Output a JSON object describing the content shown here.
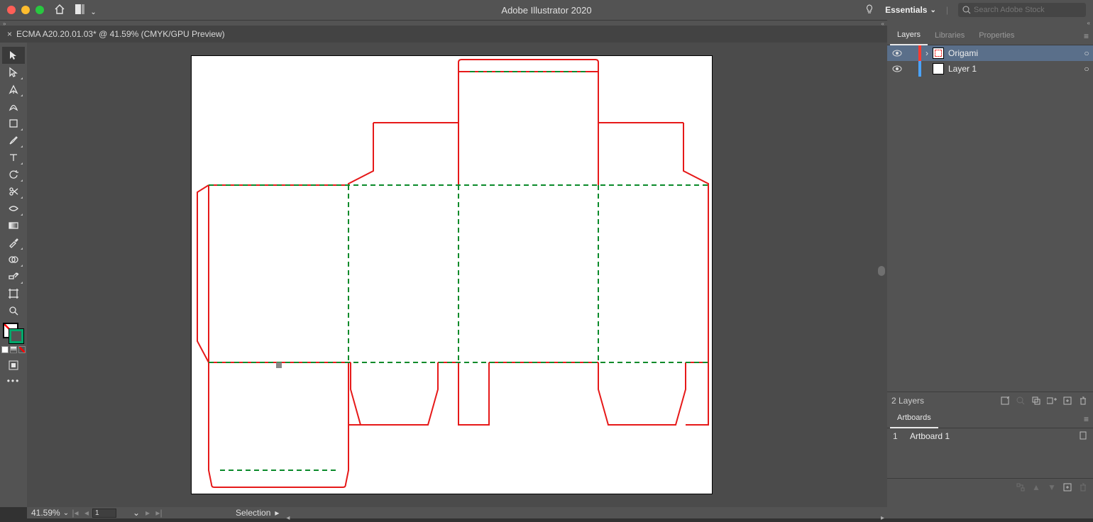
{
  "app": {
    "title": "Adobe Illustrator 2020"
  },
  "traffic_lights": {
    "close": "#ff5f57",
    "min": "#febc2e",
    "max": "#28c840"
  },
  "header": {
    "workspace_label": "Essentials",
    "search_placeholder": "Search Adobe Stock"
  },
  "document_tab": {
    "close_glyph": "×",
    "label": "ECMA A20.20.01.03* @ 41.59% (CMYK/GPU Preview)"
  },
  "tools": [
    {
      "name": "selection-tool",
      "selected": true
    },
    {
      "name": "direct-selection-tool"
    },
    {
      "name": "pen-tool"
    },
    {
      "name": "curvature-tool"
    },
    {
      "name": "rectangle-tool"
    },
    {
      "name": "paintbrush-tool"
    },
    {
      "name": "type-tool"
    },
    {
      "name": "rotate-tool"
    },
    {
      "name": "scissors-tool"
    },
    {
      "name": "width-tool"
    },
    {
      "name": "gradient-tool"
    },
    {
      "name": "eyedropper-tool"
    },
    {
      "name": "shape-builder-tool"
    },
    {
      "name": "symbol-sprayer-tool"
    },
    {
      "name": "artboard-tool"
    },
    {
      "name": "zoom-tool"
    }
  ],
  "panels": {
    "layers": {
      "tabs": [
        "Layers",
        "Libraries",
        "Properties"
      ],
      "active_tab": "Layers",
      "items": [
        {
          "name": "Origami",
          "color": "#ff3b30",
          "expandable": true,
          "thumb": "origami"
        },
        {
          "name": "Layer 1",
          "color": "#4aa3ff",
          "expandable": false,
          "thumb": "blank"
        }
      ],
      "footer_count": "2 Layers"
    },
    "artboards": {
      "title": "Artboards",
      "items": [
        {
          "index": "1",
          "name": "Artboard 1"
        }
      ]
    }
  },
  "status": {
    "zoom": "41.59%",
    "artboard_number": "1",
    "current_tool": "Selection"
  },
  "panel_footer_icons": {
    "locate": true,
    "search": true,
    "collect": true,
    "sublayer": true,
    "new": true,
    "trash": true
  }
}
